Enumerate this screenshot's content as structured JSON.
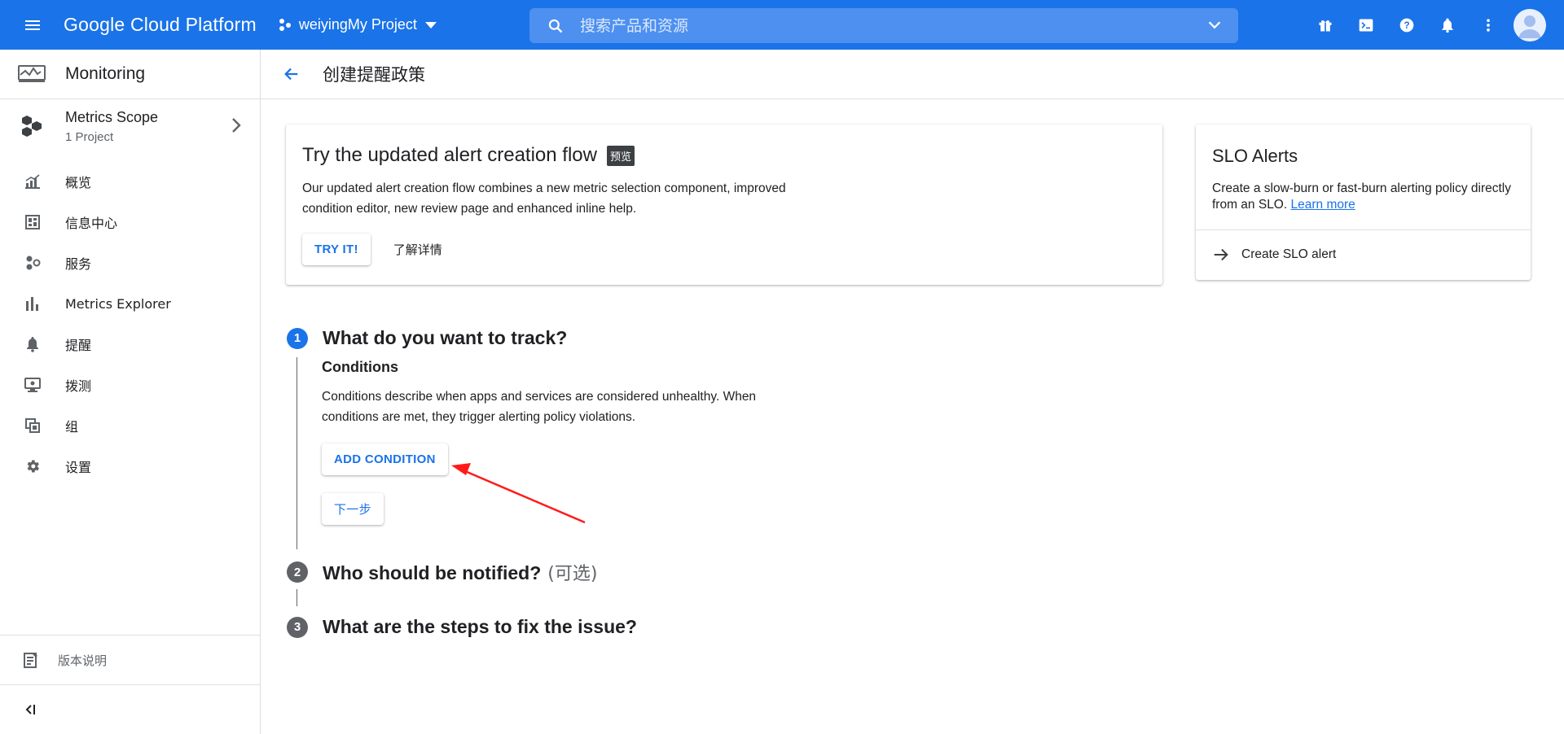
{
  "topbar": {
    "brand": "Google Cloud Platform",
    "project": "weiyingMy Project",
    "search_placeholder": "搜索产品和资源",
    "accent": "#1a73e8",
    "icons": [
      "menu-icon",
      "gift-icon",
      "terminal-icon",
      "help-icon",
      "notifications-icon",
      "more-vert-icon",
      "avatar"
    ]
  },
  "sidebar": {
    "title": "Monitoring",
    "scope": {
      "title": "Metrics Scope",
      "subtitle": "1 Project"
    },
    "items": [
      {
        "label": "概览",
        "icon": "chart-icon"
      },
      {
        "label": "信息中心",
        "icon": "dashboard-icon"
      },
      {
        "label": "服务",
        "icon": "services-icon"
      },
      {
        "label": "Metrics Explorer",
        "icon": "bar-chart-icon"
      },
      {
        "label": "提醒",
        "icon": "bell-icon"
      },
      {
        "label": "拨测",
        "icon": "monitor-icon"
      },
      {
        "label": "组",
        "icon": "group-icon"
      },
      {
        "label": "设置",
        "icon": "gear-icon"
      }
    ],
    "release_notes": "版本说明"
  },
  "header": {
    "title": "创建提醒政策"
  },
  "try_card": {
    "title": "Try the updated alert creation flow",
    "badge": "预览",
    "description": "Our updated alert creation flow combines a new metric selection component, improved condition editor, new review page and enhanced inline help.",
    "try_button": "TRY IT!",
    "learn_more": "了解详情"
  },
  "slo_card": {
    "title": "SLO Alerts",
    "description": "Create a slow-burn or fast-burn alerting policy directly from an SLO.",
    "link": "Learn more",
    "action": "Create SLO alert"
  },
  "steps": [
    {
      "num": "1",
      "title": "What do you want to track?",
      "color": "#1a73e8"
    },
    {
      "num": "2",
      "title": "Who should be notified?",
      "optional": "(可选)",
      "color": "#5f6368"
    },
    {
      "num": "3",
      "title": "What are the steps to fix the issue?",
      "color": "#5f6368"
    }
  ],
  "conditions": {
    "title": "Conditions",
    "description": "Conditions describe when apps and services are considered unhealthy. When conditions are met, they trigger alerting policy violations.",
    "add_button": "ADD CONDITION",
    "next_button": "下一步"
  },
  "annotation_color": "#ff1a1a"
}
